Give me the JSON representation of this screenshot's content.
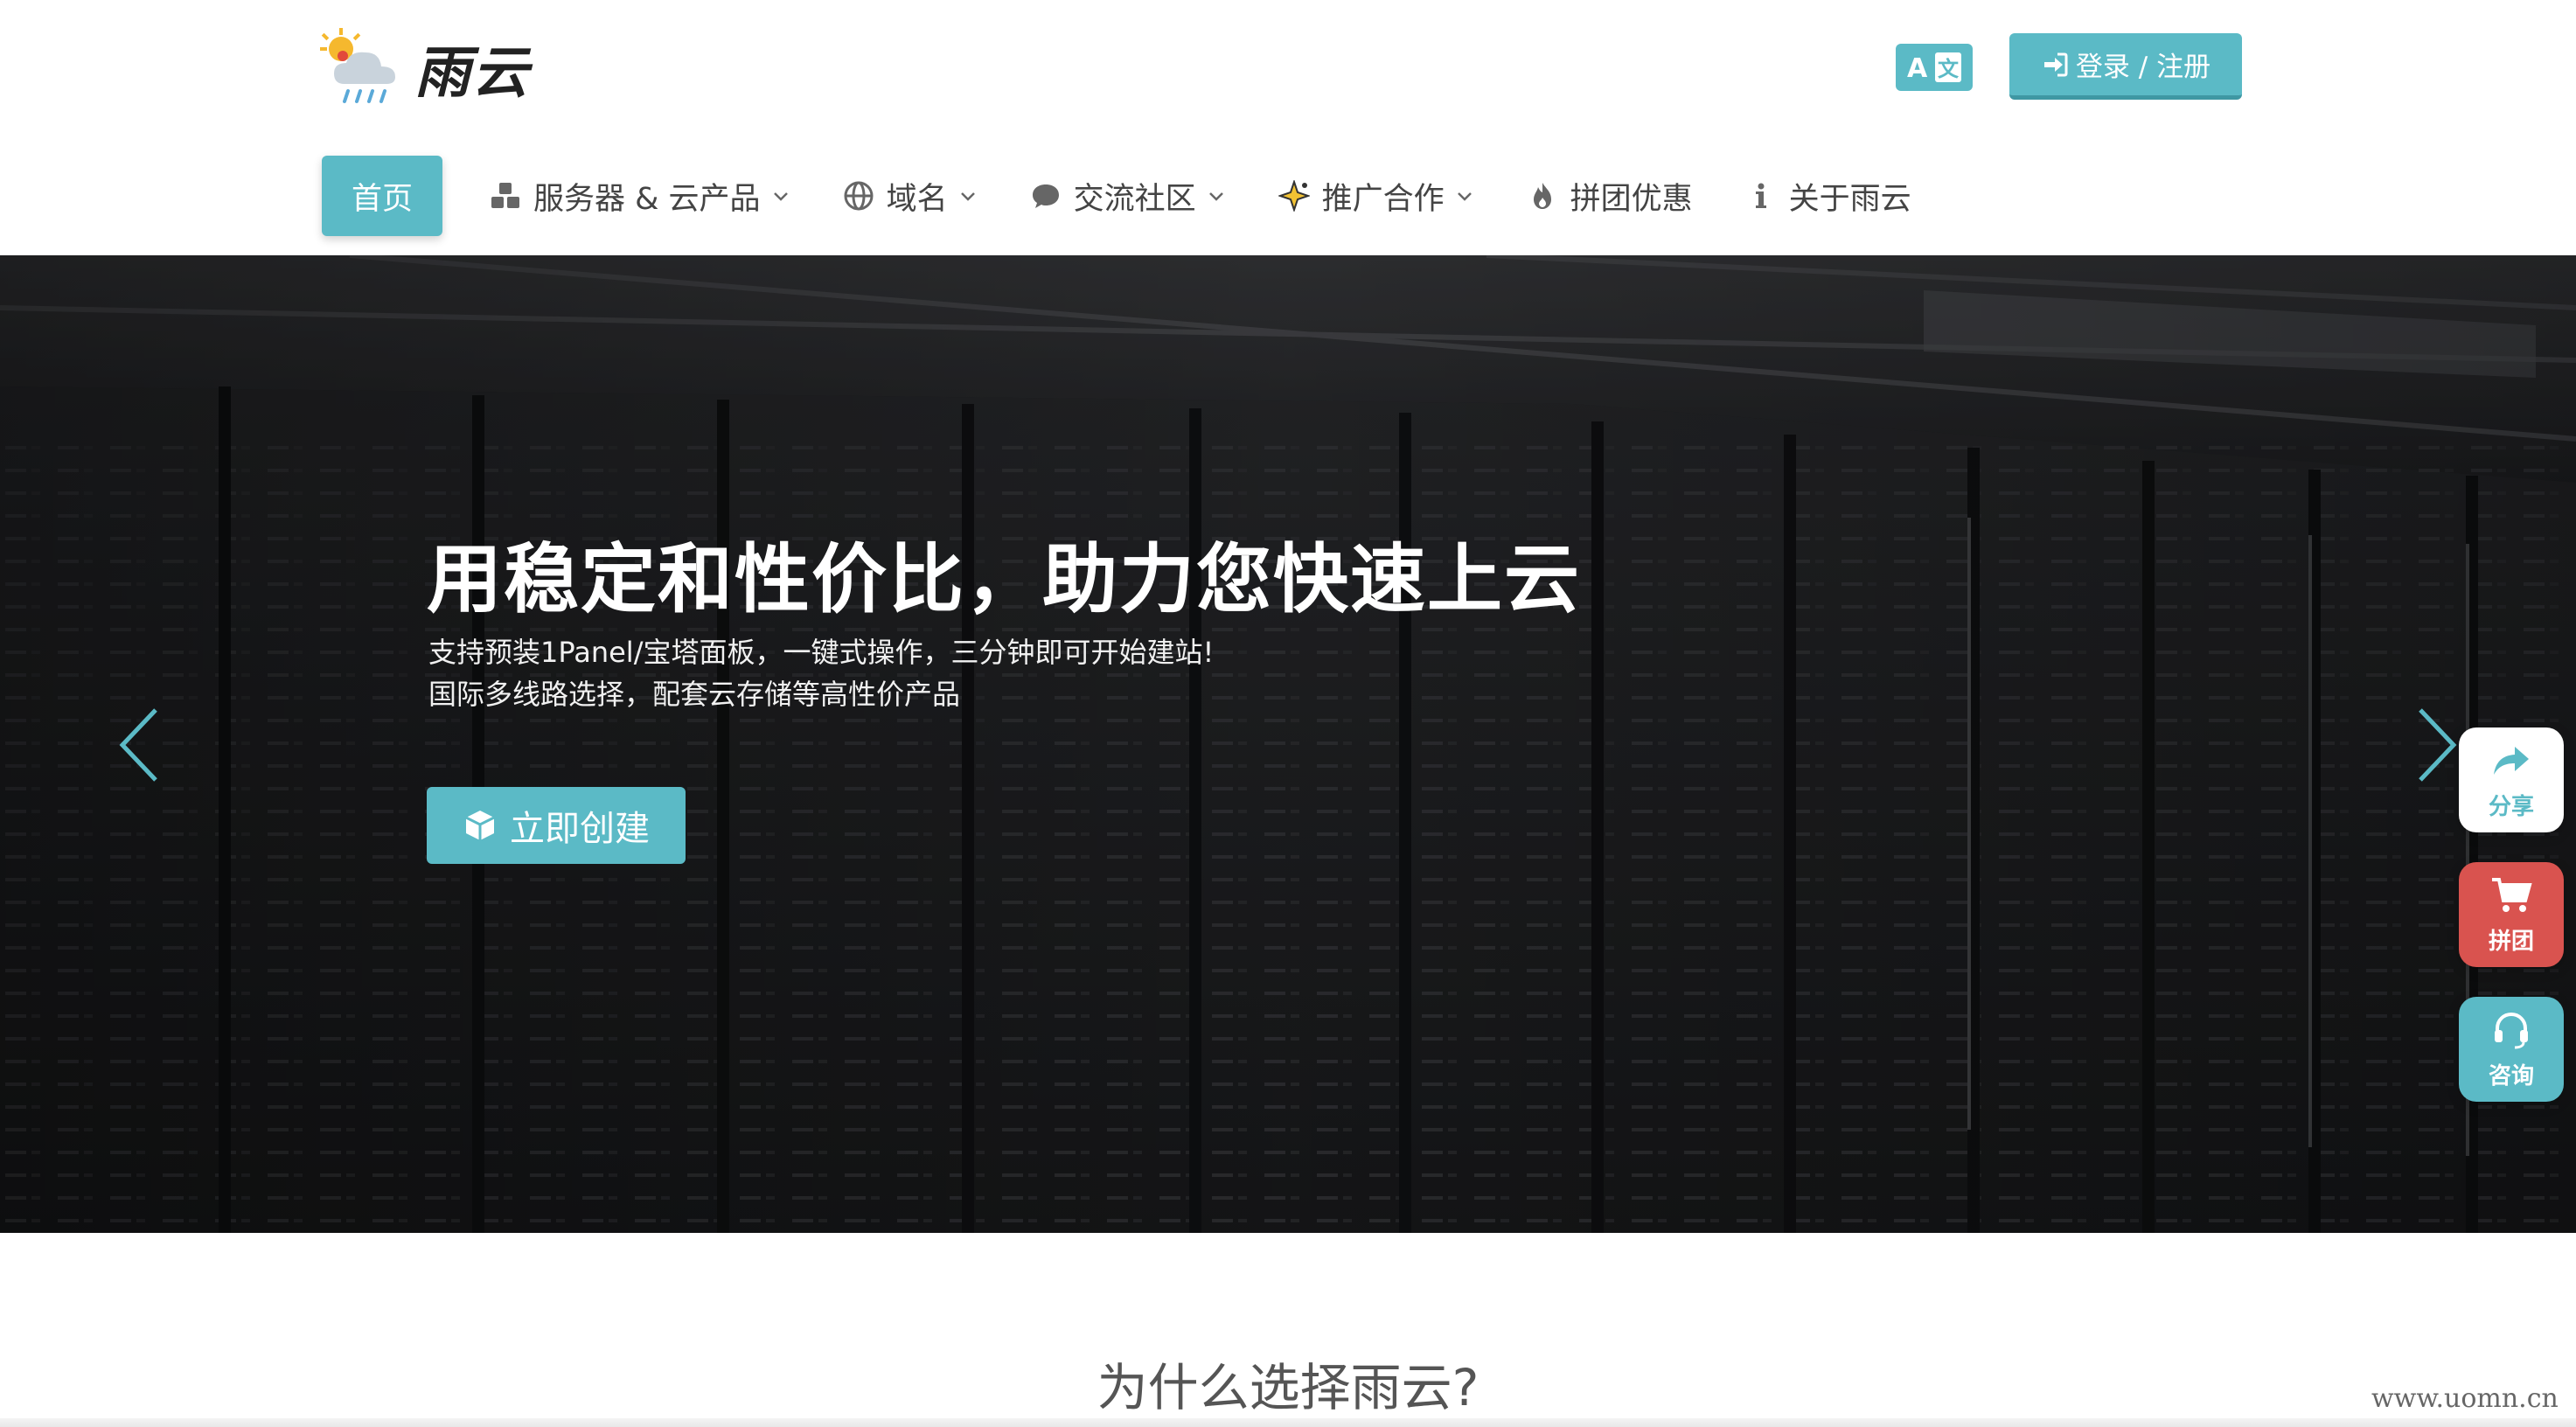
{
  "brand": {
    "name": "雨云"
  },
  "header": {
    "login_label": "登录 / 注册"
  },
  "nav": [
    {
      "label": "首页"
    },
    {
      "label": "服务器 & 云产品"
    },
    {
      "label": "域名"
    },
    {
      "label": "交流社区"
    },
    {
      "label": "推广合作"
    },
    {
      "label": "拼团优惠"
    },
    {
      "label": "关于雨云"
    }
  ],
  "hero": {
    "title": "用稳定和性价比，助力您快速上云",
    "subtitle_line1": "支持预装1Panel/宝塔面板，一键式操作，三分钟即可开始建站!",
    "subtitle_line2": "国际多线路选择，配套云存储等高性价产品",
    "cta_label": "立即创建"
  },
  "float_buttons": {
    "share": "分享",
    "group": "拼团",
    "consult": "咨询"
  },
  "section": {
    "title": "为什么选择雨云?"
  },
  "watermark": "www.uomn.cn",
  "colors": {
    "accent": "#5bbac6",
    "danger": "#d9534f"
  },
  "icons": [
    "cloud-sun-rain-icon",
    "translate-icon",
    "sign-in-icon",
    "cubes-icon",
    "globe-icon",
    "comment-icon",
    "sparkle-icon",
    "fire-icon",
    "info-icon",
    "chevron-down-icon",
    "box-icon",
    "share-icon",
    "cart-icon",
    "headset-icon"
  ]
}
